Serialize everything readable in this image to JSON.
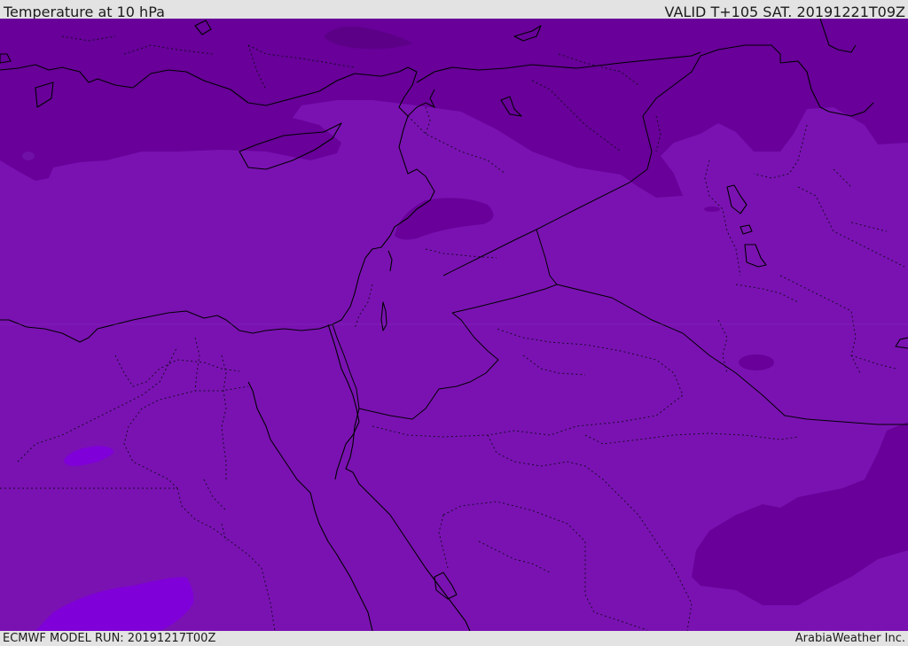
{
  "header": {
    "title": "Temperature at 10 hPa",
    "valid_time": "VALID T+105 SAT. 20191221T09Z"
  },
  "footer": {
    "model_run": "ECMWF MODEL RUN: 20191217T00Z",
    "credit": "ArabiaWeather Inc."
  },
  "map": {
    "colors": {
      "base_field": "#7a12b2",
      "cold_band": "#680099",
      "coldest_patch": "#5c0088",
      "warm_band": "#7f00d8",
      "coastline": "#000000",
      "borders": "#1a0a2a"
    }
  }
}
